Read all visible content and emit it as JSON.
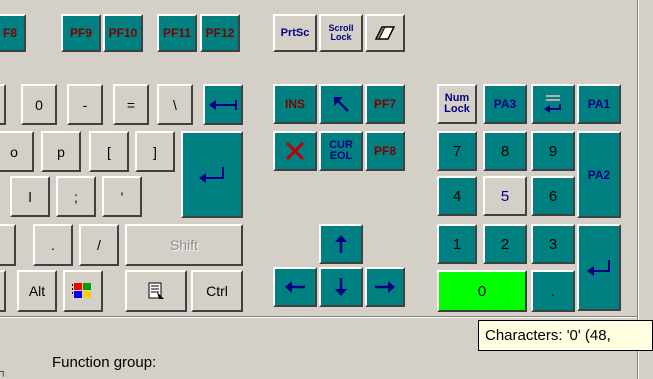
{
  "top_row": {
    "f8": "F8",
    "pf9": "PF9",
    "pf10": "PF10",
    "pf11": "PF11",
    "pf12": "PF12",
    "prtsc": "PrtSc",
    "scroll_lock_1": "Scroll",
    "scroll_lock_2": "Lock",
    "eraser_icon": "eraser-icon"
  },
  "row2": {
    "zero": "0",
    "minus": "-",
    "equals": "=",
    "backslash": "\\"
  },
  "row3": {
    "o": "o",
    "p": "p",
    "lbracket": "[",
    "rbracket": "]"
  },
  "row4": {
    "l": "l",
    "semicolon": ";",
    "quote": "'"
  },
  "row5": {
    "period": ".",
    "slash": "/",
    "shift": "Shift"
  },
  "row6": {
    "alt": "Alt",
    "ctrl": "Ctrl"
  },
  "edit": {
    "ins": "INS",
    "pf7": "PF7",
    "cur_1": "CUR",
    "cur_2": "EOL",
    "pf8": "PF8"
  },
  "numpad": {
    "numlock_1": "Num",
    "numlock_2": "Lock",
    "pa3": "PA3",
    "pa1": "PA1",
    "pa2": "PA2",
    "n7": "7",
    "n8": "8",
    "n9": "9",
    "n4": "4",
    "n5": "5",
    "n6": "6",
    "n1": "1",
    "n2": "2",
    "n3": "3",
    "n0": "0",
    "dot": "."
  },
  "tooltip": "Characters: '0'  (48,",
  "function_group_label": "Function group:",
  "corner_mark": "┐",
  "colors": {
    "teal": "#008080",
    "face": "#d4d0c8",
    "selected": "#00ff00",
    "tooltip_bg": "#ffffe1"
  }
}
